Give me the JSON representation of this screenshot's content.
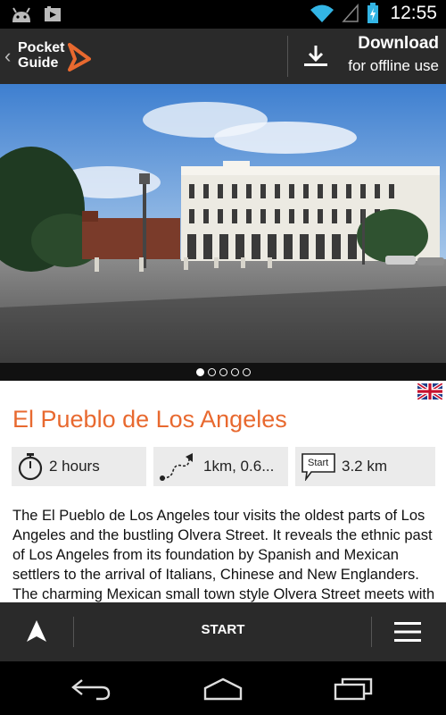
{
  "status_bar": {
    "time": "12:55"
  },
  "app_bar": {
    "logo_line1": "Pocket",
    "logo_line2": "Guide",
    "download_title": "Download",
    "download_subtitle": "for offline use"
  },
  "gallery": {
    "page_count": 5,
    "active_page": 1
  },
  "tour": {
    "language": "English",
    "title": "El Pueblo de Los Angeles",
    "stats": {
      "duration": "2 hours",
      "distance": "1km, 0.6...",
      "start_label": "Start",
      "start_distance": "3.2 km"
    },
    "description": "The El Pueblo de Los Angeles tour visits the oldest parts of Los Angeles and the bustling Olvera Street. It reveals the ethnic past of Los Angeles from its foundation by Spanish and Mexican settlers to the arrival of Italians, Chinese and New Englanders. The charming Mexican small town style Olvera Street meets with the busy plaza"
  },
  "bottom_bar": {
    "start_label": "START"
  },
  "icons": {
    "navigate": "navigation-arrow-icon",
    "menu": "hamburger-menu-icon",
    "download": "download-icon",
    "timer": "stopwatch-icon",
    "route": "route-icon",
    "start": "start-flag-icon"
  },
  "colors": {
    "accent": "#e8692f",
    "bar": "#2a2a2a",
    "stat_bg": "#ebebeb"
  }
}
